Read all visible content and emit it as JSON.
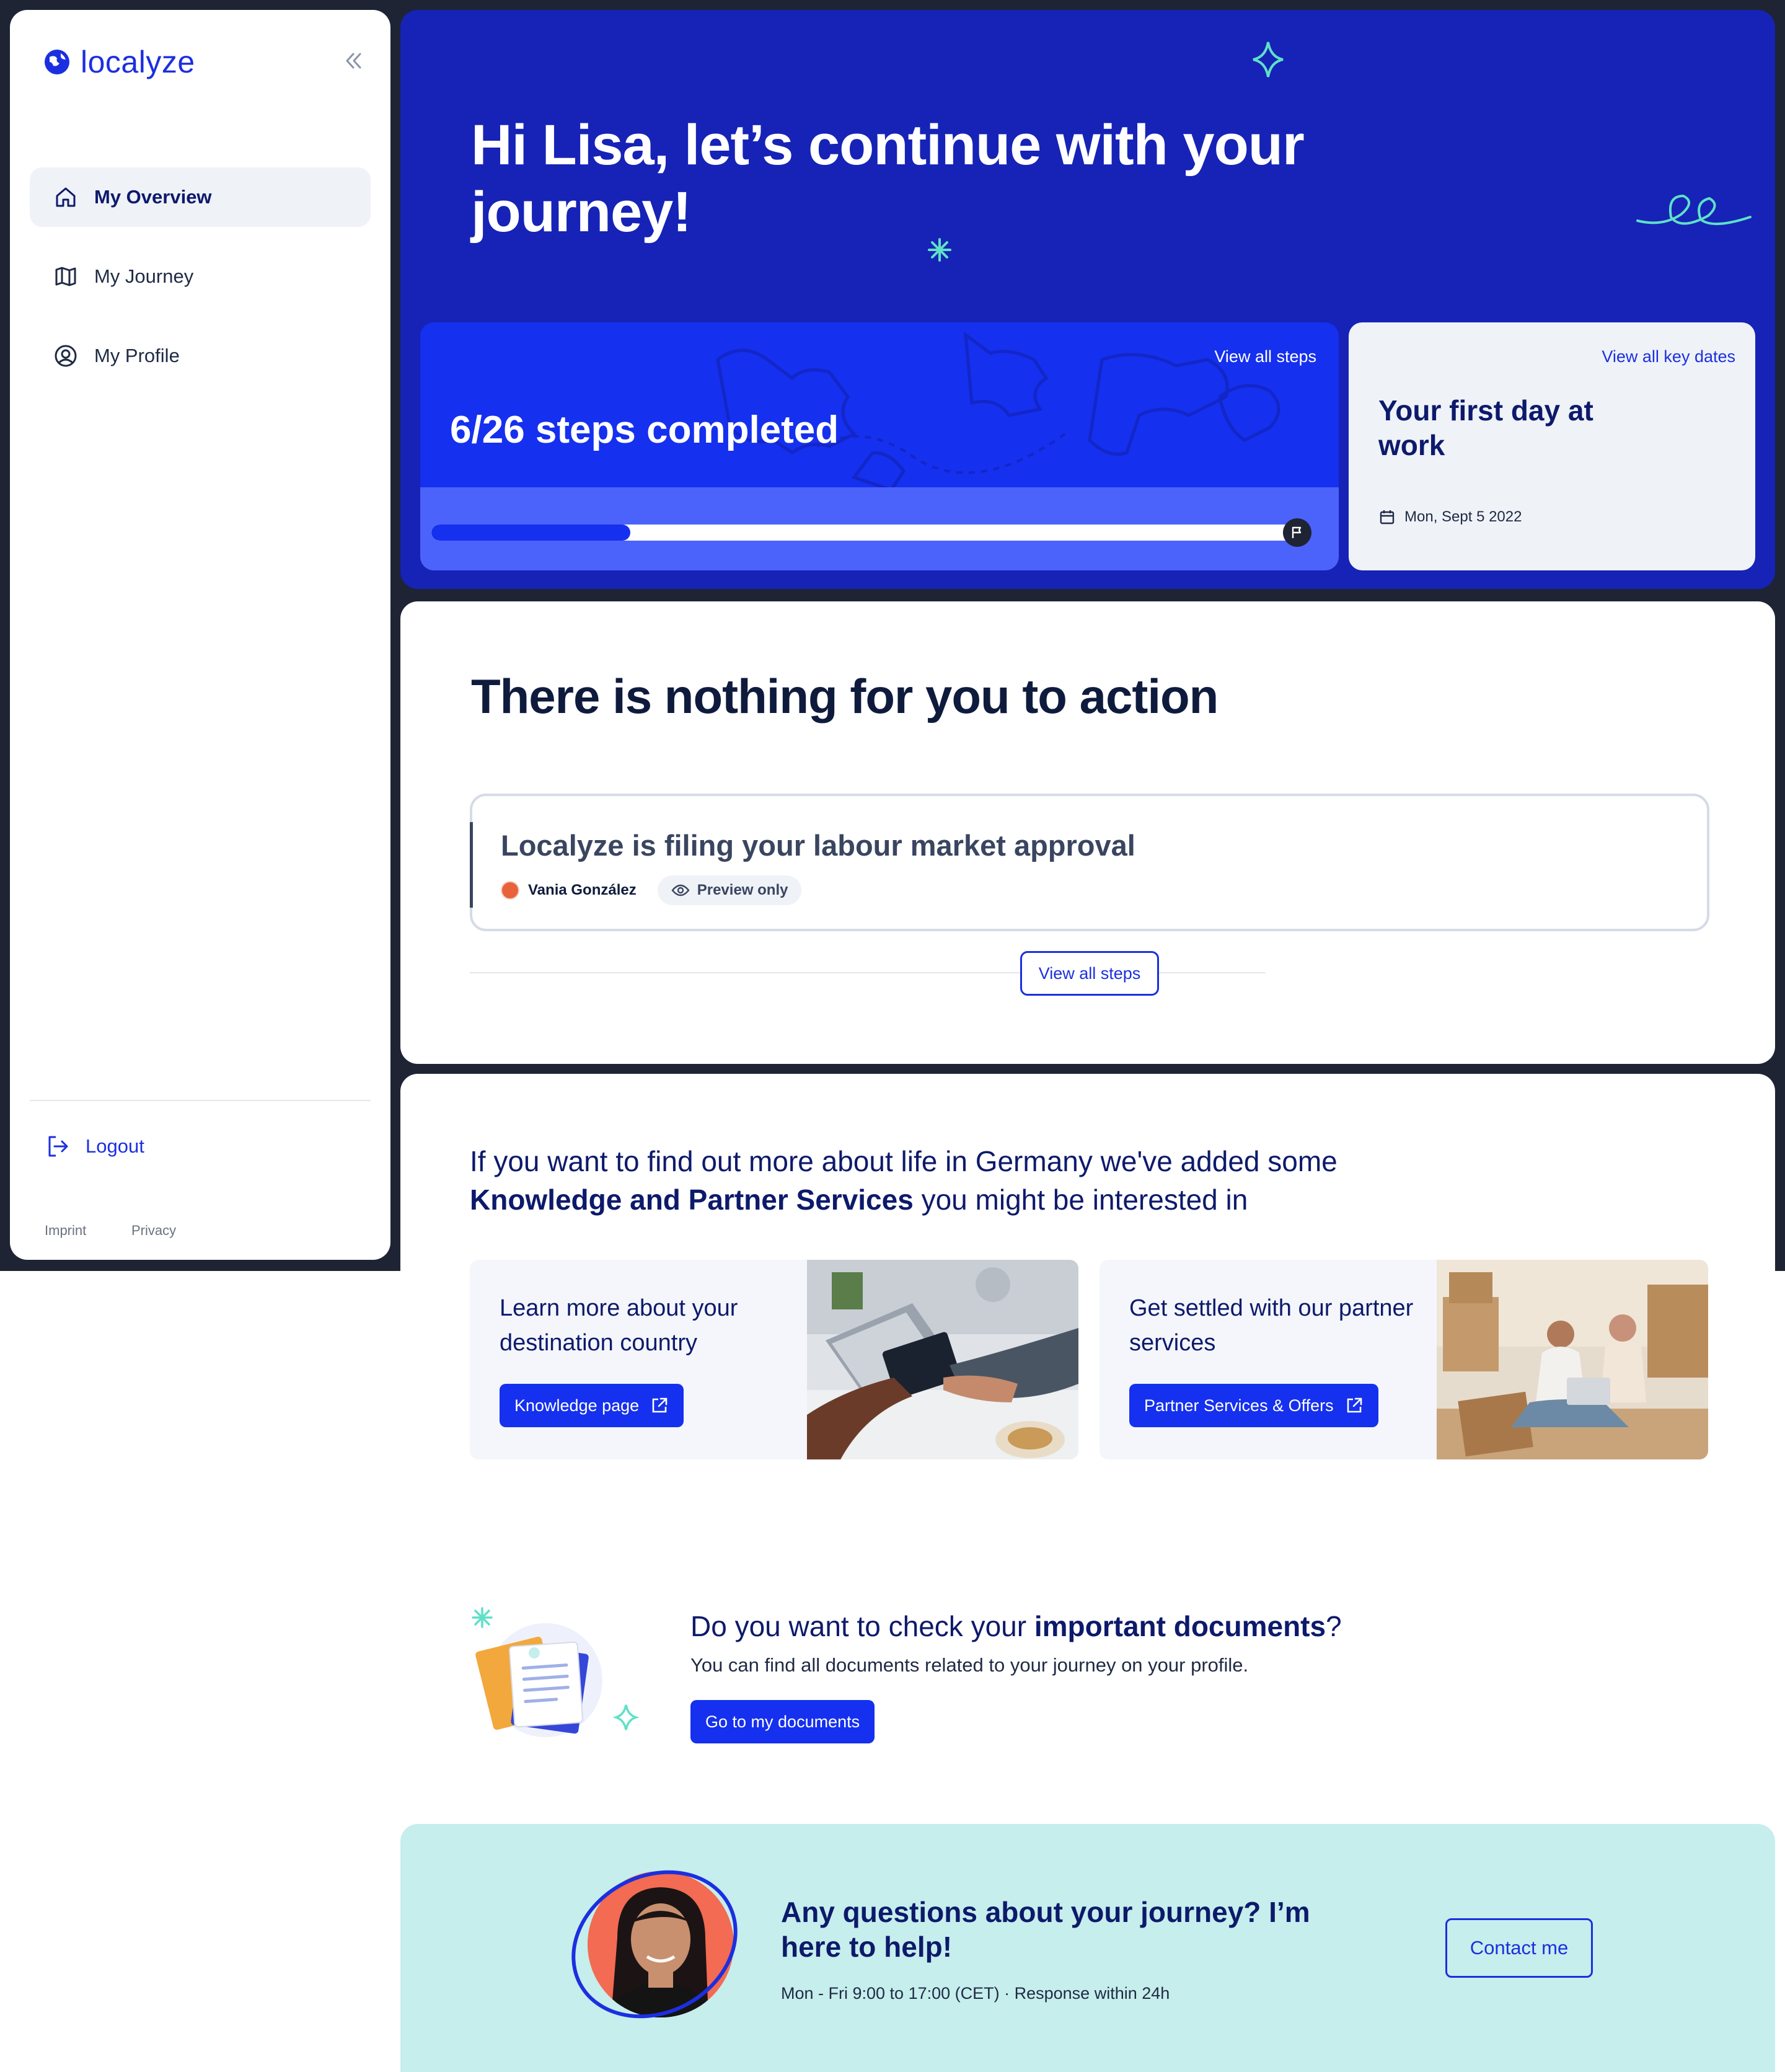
{
  "app": {
    "logo_text": "localyze"
  },
  "sidebar": {
    "items": [
      {
        "label": "My Overview",
        "icon": "home-icon",
        "active": true
      },
      {
        "label": "My Journey",
        "icon": "map-icon",
        "active": false
      },
      {
        "label": "My Profile",
        "icon": "user-circle-icon",
        "active": false
      }
    ],
    "logout_label": "Logout",
    "footer": {
      "imprint": "Imprint",
      "privacy": "Privacy"
    }
  },
  "hero": {
    "title": "Hi Lisa, let’s continue with your journey!",
    "steps": {
      "title": "6/26 steps completed",
      "completed": 6,
      "total": 26,
      "link": "View all steps"
    },
    "key_date": {
      "link": "View all key dates",
      "title": "Your first day at work",
      "date": "Mon, Sept 5 2022"
    }
  },
  "action": {
    "title": "There is nothing for you to action",
    "task": {
      "title": "Localyze is filing your labour market approval",
      "assignee": "Vania González",
      "badge": "Preview only"
    },
    "view_all": "View all steps"
  },
  "knowledge": {
    "intro_plain_1": "If you want to find out more about life in Germany we've added some ",
    "intro_bold": "Knowledge and Partner Services",
    "intro_plain_2": " you might be interested in",
    "cards": [
      {
        "title": "Learn more about your destination country",
        "button": "Knowledge page"
      },
      {
        "title": "Get settled with our partner services",
        "button": "Partner Services & Offers"
      }
    ]
  },
  "documents": {
    "title_plain": "Do you want to check your ",
    "title_bold": "important documents",
    "title_end": "?",
    "subtitle": "You can find all documents related to your journey on your profile.",
    "button": "Go to my documents"
  },
  "contact": {
    "title": "Any questions about your journey? I’m here to help!",
    "hours": "Mon - Fri 9:00 to 17:00 (CET) · Response within 24h",
    "button": "Contact me"
  },
  "colors": {
    "brand_blue": "#1c2fe0",
    "hero_bg": "#1623b6",
    "accent_mint": "#5fe0c8",
    "contact_bg": "#c6eeec",
    "page_dark": "#1e2433"
  }
}
